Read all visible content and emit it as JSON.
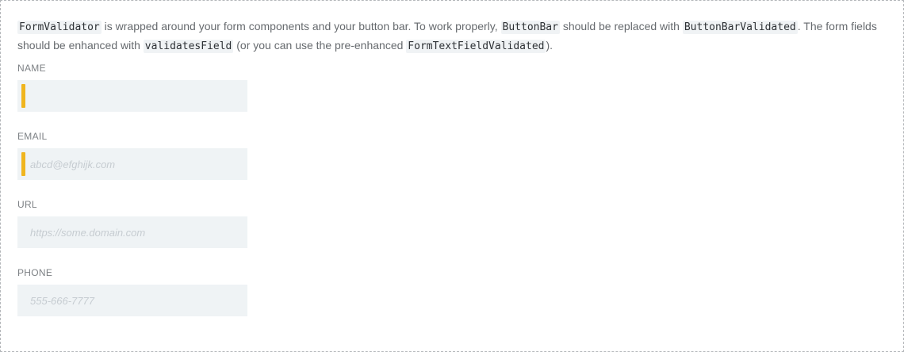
{
  "intro": {
    "t1": "FormValidator",
    "t2": " is wrapped around your form components and your button bar. To work properly, ",
    "t3": "ButtonBar",
    "t4": " should be replaced with ",
    "t5": "ButtonBarValidated",
    "t6": ". The form fields should be enhanced with ",
    "t7": "validatesField",
    "t8": " (or you can use the pre-enhanced ",
    "t9": "FormTextFieldValidated",
    "t10": ")."
  },
  "form": {
    "name": {
      "label": "NAME",
      "value": "",
      "placeholder": "",
      "required": true
    },
    "email": {
      "label": "EMAIL",
      "value": "",
      "placeholder": "abcd@efghijk.com",
      "required": true
    },
    "url": {
      "label": "URL",
      "value": "",
      "placeholder": "https://some.domain.com",
      "required": false
    },
    "phone": {
      "label": "PHONE",
      "value": "",
      "placeholder": "555-666-7777",
      "required": false
    }
  },
  "colors": {
    "required_indicator": "#f0b51e",
    "input_background": "#eff3f5"
  }
}
